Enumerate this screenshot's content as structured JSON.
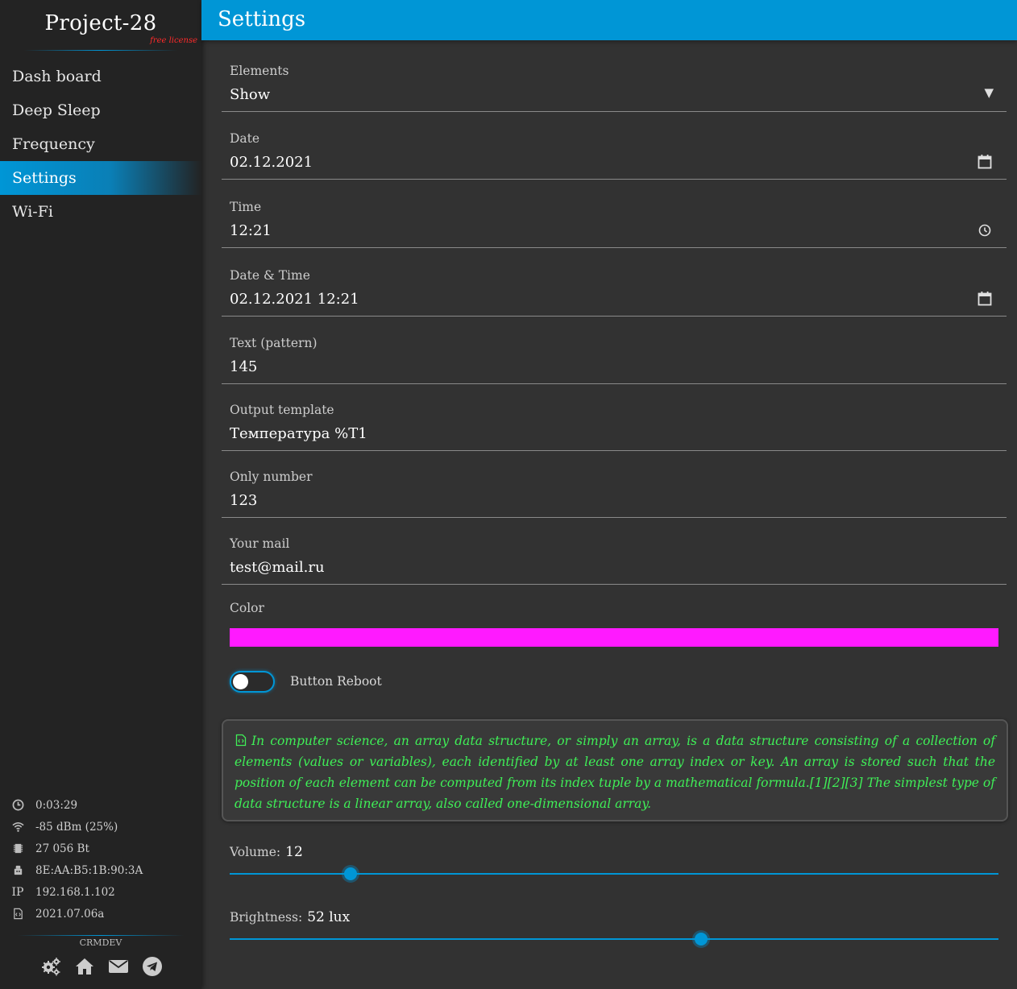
{
  "sidebar": {
    "brand_title": "Project-28",
    "brand_license": "free license",
    "nav": [
      {
        "label": "Dash board",
        "active": false
      },
      {
        "label": "Deep Sleep",
        "active": false
      },
      {
        "label": "Frequency",
        "active": false
      },
      {
        "label": "Settings",
        "active": true
      },
      {
        "label": "Wi-Fi",
        "active": false
      }
    ],
    "status": {
      "uptime": "0:03:29",
      "wifi": "-85 dBm (25%)",
      "memory": "27 056 Bt",
      "mac": "8E:AA:B5:1B:90:3A",
      "ip_label": "IP",
      "ip": "192.168.1.102",
      "firmware": "2021.07.06a"
    },
    "footer_brand": "CRMDEV"
  },
  "header": {
    "title": "Settings"
  },
  "form": {
    "elements": {
      "label": "Elements",
      "value": "Show",
      "arrow": "▼"
    },
    "date": {
      "label": "Date",
      "value": "02.12.2021"
    },
    "time": {
      "label": "Time",
      "value": "12:21"
    },
    "datetime": {
      "label": "Date & Time",
      "value": "02.12.2021 12:21"
    },
    "text_pattern": {
      "label": "Text (pattern)",
      "value": "145"
    },
    "output_template": {
      "label": "Output template",
      "value": "Температура %T1"
    },
    "only_number": {
      "label": "Only number",
      "value": "123"
    },
    "mail": {
      "label": "Your mail",
      "value": "test@mail.ru"
    },
    "color": {
      "label": "Color",
      "value": "#ff1aff"
    },
    "toggle": {
      "label": "Button Reboot",
      "checked": false
    }
  },
  "note": {
    "text": "In computer science, an array data structure, or simply an array, is a data structure consisting of a collection of elements (values or variables), each identified by at least one array index or key. An array is stored such that the position of each element can be computed from its index tuple by a mathematical formula.[1][2][3] The simplest type of data structure is a linear array, also called one-dimensional array."
  },
  "sliders": {
    "volume": {
      "label": "Volume:",
      "value_text": "12",
      "fraction": 0.157
    },
    "brightness": {
      "label": "Brightness:",
      "value_text": "52 lux",
      "fraction": 0.613
    }
  },
  "colors": {
    "accent": "#0096d6",
    "note_text": "#3fef57",
    "license_text": "#ff2a2a"
  }
}
